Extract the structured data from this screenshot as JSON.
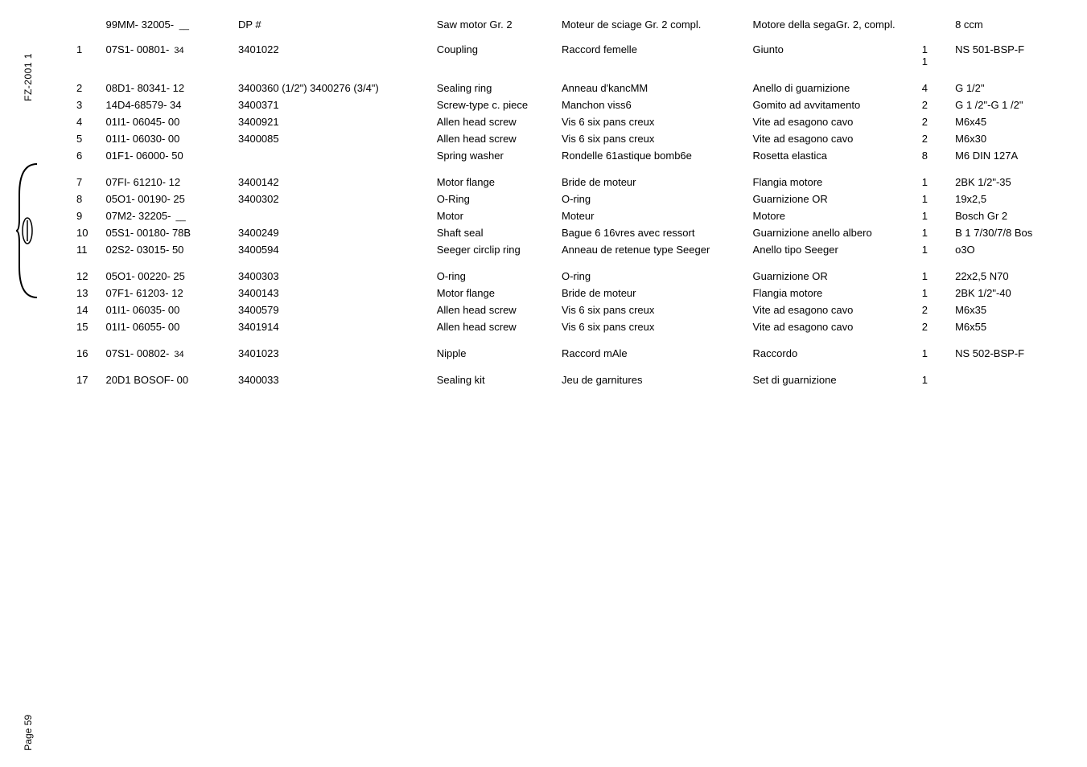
{
  "side_label": "FZ-2001 1",
  "footer": "Page 59",
  "header": {
    "part": "99MM- 32005-",
    "part_suffix": "__",
    "dp": "DP #",
    "en": "Saw motor Gr. 2",
    "fr": "Moteur de sciage Gr. 2 compl.",
    "it": "Motore della segaGr. 2, compl.",
    "spec": "8 ccm"
  },
  "rows": [
    {
      "idx": "1",
      "part": "07S1- 00801-",
      "part_suffix": "34",
      "dp": "3401022",
      "en": "Coupling",
      "fr": "Raccord femelle",
      "it": "Giunto",
      "qty": "1",
      "spec": "NS 501-BSP-F",
      "extra_qty": "1"
    },
    {
      "gap": true
    },
    {
      "idx": "2",
      "part": "08D1- 80341- 12",
      "dp": "3400360 (1/2\")  3400276  (3/4\")",
      "en": "Sealing ring",
      "fr": "Anneau d'kancMM",
      "it": "Anello di guarnizione",
      "qty": "4",
      "spec": "G 1/2\""
    },
    {
      "idx": "3",
      "part": "14D4-68579-   34",
      "dp": "3400371",
      "en": "Screw-type c. piece",
      "fr": "Manchon viss6",
      "it": "Gomito ad avvitamento",
      "qty": "2",
      "spec": "G 1 /2\"-G 1 /2\""
    },
    {
      "idx": "4",
      "part": "01I1- 06045- 00",
      "dp": "3400921",
      "en": "Allen head screw",
      "fr": "Vis 6 six pans creux",
      "it": "Vite ad esagono cavo",
      "qty": "2",
      "spec": "M6x45"
    },
    {
      "idx": "5",
      "part": "01I1- 06030- 00",
      "dp": "3400085",
      "en": "Allen head screw",
      "fr": "Vis 6 six pans creux",
      "it": "Vite ad esagono cavo",
      "qty": "2",
      "spec": "M6x30"
    },
    {
      "idx": "6",
      "part": "01F1- 06000- 50",
      "dp": "",
      "en": "Spring washer",
      "fr": "Rondelle 61astique bomb6e",
      "it": "Rosetta elastica",
      "qty": "8",
      "spec": "M6 DIN 127A"
    },
    {
      "gap": true
    },
    {
      "idx": "7",
      "part": "07FI- 61210- 12",
      "dp": "3400142",
      "en": "Motor flange",
      "fr": "Bride de moteur",
      "it": "Flangia motore",
      "qty": "1",
      "spec": "2BK 1/2\"-35"
    },
    {
      "idx": "8",
      "part": "05O1- 00190- 25",
      "dp": "3400302",
      "en": "O-Ring",
      "fr": "O-ring",
      "it": "Guarnizione OR",
      "qty": "1",
      "spec": "19x2,5"
    },
    {
      "idx": "9",
      "part": "07M2- 32205-",
      "part_suffix": "__",
      "dp": "",
      "en": "Motor",
      "fr": "Moteur",
      "it": "Motore",
      "qty": "1",
      "spec": "Bosch Gr 2"
    },
    {
      "idx": "10",
      "part": "05S1- 00180- 78B",
      "dp": "3400249",
      "en": "Shaft seal",
      "fr": "Bague 6 16vres avec ressort",
      "it": "Guarnizione anello albero",
      "qty": "1",
      "spec": "B 1 7/30/7/8 Bos"
    },
    {
      "idx": "11",
      "part": "02S2- 03015- 50",
      "dp": "3400594",
      "en": "  Seeger circlip ring",
      "fr": "Anneau de retenue type Seeger",
      "it": "Anello tipo Seeger",
      "qty": "1",
      "spec": "   o3O"
    },
    {
      "gap": true
    },
    {
      "idx": "12",
      "part": "05O1- 00220- 25",
      "dp": "3400303",
      "en": "O-ring",
      "fr": "O-ring",
      "it": "Guarnizione OR",
      "qty": "1",
      "spec": "22x2,5 N70"
    },
    {
      "idx": "13",
      "part": "07F1- 61203- 12",
      "dp": "3400143",
      "en": "Motor flange",
      "fr": "Bride de moteur",
      "it": "Flangia motore",
      "qty": "1",
      "spec": "2BK 1/2\"-40"
    },
    {
      "idx": "14",
      "part": "01I1- 06035- 00",
      "dp": "3400579",
      "en": "Allen head screw",
      "fr": "Vis 6 six pans creux",
      "it": "Vite ad esagono cavo",
      "qty": "2",
      "spec": "M6x35"
    },
    {
      "idx": "15",
      "part": "01I1- 06055- 00",
      "dp": "3401914",
      "en": "Allen head screw",
      "fr": "Vis 6 six pans creux",
      "it": "Vite ad esagono cavo",
      "qty": "2",
      "spec": "M6x55"
    },
    {
      "gap": true
    },
    {
      "idx": "16",
      "part": "07S1- 00802-",
      "part_suffix": "34",
      "dp": "3401023",
      "en": "Nipple",
      "fr": "Raccord mAle",
      "it": "Raccordo",
      "qty": "1",
      "spec": "NS 502-BSP-F"
    },
    {
      "gap": true
    },
    {
      "idx": "17",
      "part": "20D1 BOSOF- 00",
      "dp": "3400033",
      "en": "Sealing kit",
      "fr": "Jeu de garnitures",
      "it": "Set di guarnizione",
      "qty": "1",
      "spec": ""
    }
  ]
}
